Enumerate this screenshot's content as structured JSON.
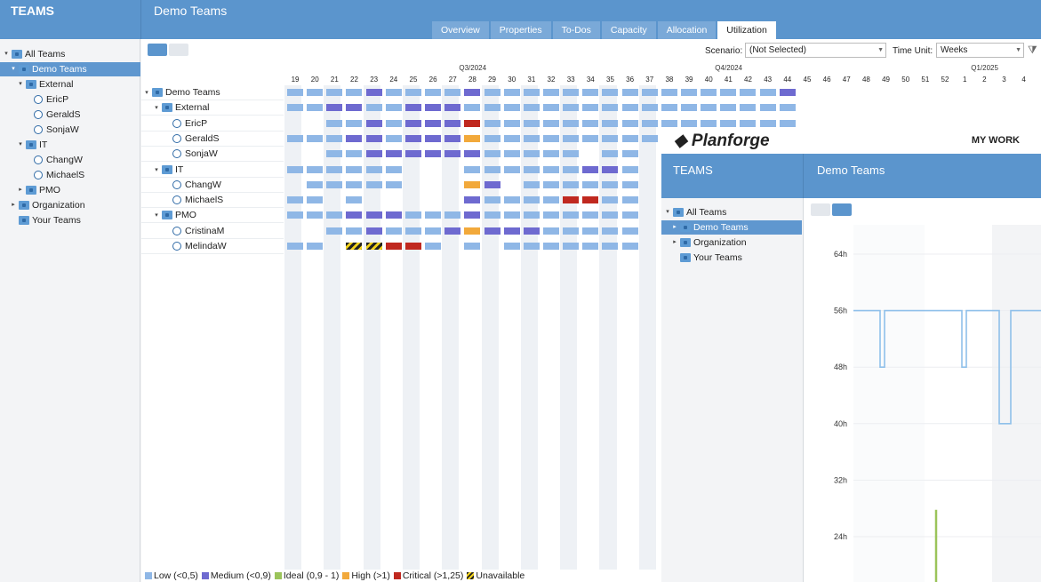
{
  "header": {
    "left_title": "TEAMS",
    "right_title": "Demo Teams"
  },
  "tabs": [
    "Overview",
    "Properties",
    "To-Dos",
    "Capacity",
    "Allocation",
    "Utilization"
  ],
  "active_tab": "Utilization",
  "sidebar": {
    "nodes": [
      {
        "label": "All Teams",
        "type": "folder",
        "level": 0,
        "caret": "▾"
      },
      {
        "label": "Demo Teams",
        "type": "folder",
        "level": 1,
        "caret": "▾",
        "selected": true
      },
      {
        "label": "External",
        "type": "folder",
        "level": 2,
        "caret": "▾"
      },
      {
        "label": "EricP",
        "type": "person",
        "level": 3
      },
      {
        "label": "GeraldS",
        "type": "person",
        "level": 3
      },
      {
        "label": "SonjaW",
        "type": "person",
        "level": 3
      },
      {
        "label": "IT",
        "type": "folder",
        "level": 2,
        "caret": "▾"
      },
      {
        "label": "ChangW",
        "type": "person",
        "level": 3
      },
      {
        "label": "MichaelS",
        "type": "person",
        "level": 3
      },
      {
        "label": "PMO",
        "type": "folder",
        "level": 2,
        "caret": "▸"
      },
      {
        "label": "Organization",
        "type": "folder",
        "level": 1,
        "caret": "▸"
      },
      {
        "label": "Your Teams",
        "type": "folder",
        "level": 1,
        "caret": ""
      }
    ]
  },
  "controls": {
    "scenario_label": "Scenario:",
    "scenario_value": "(Not Selected)",
    "time_unit_label": "Time Unit:",
    "time_unit_value": "Weeks"
  },
  "quarters": [
    {
      "label": "Q3/2024",
      "col": 9
    },
    {
      "label": "Q4/2024",
      "col": 22
    },
    {
      "label": "Q1/2025",
      "col": 35
    }
  ],
  "weeks": [
    "19",
    "20",
    "21",
    "22",
    "23",
    "24",
    "25",
    "26",
    "27",
    "28",
    "29",
    "30",
    "31",
    "32",
    "33",
    "34",
    "35",
    "36",
    "37",
    "38",
    "39",
    "40",
    "41",
    "42",
    "43",
    "44",
    "45",
    "46",
    "47",
    "48",
    "49",
    "50",
    "51",
    "52",
    "1",
    "2",
    "3",
    "4"
  ],
  "rows": [
    {
      "label": "Demo Teams",
      "type": "folder",
      "level": 0,
      "caret": "▾",
      "cells": "LLLLMLLLLMLLLLLLLLLLLLLLLMILLLLLLLLLLL"
    },
    {
      "label": "External",
      "type": "folder",
      "level": 1,
      "caret": "▾",
      "cells": "LLMMLLMMMLLLLLLLLLLLLLLLLLLLLLLLLLLLLL"
    },
    {
      "label": "EricP",
      "type": "person",
      "level": 2,
      "cells": "__LLMLMMMCLLLLLLLLLLLLLLLLLLLLLLLLLLLL"
    },
    {
      "label": "GeraldS",
      "type": "person",
      "level": 2,
      "cells": "LLLMMLMMMHLLLLLLLLLLLLLLLLLLLLLLLLLLLL"
    },
    {
      "label": "SonjaW",
      "type": "person",
      "level": 2,
      "cells": "__LLMMMMMMLLLLL_LL______________________"
    },
    {
      "label": "IT",
      "type": "folder",
      "level": 1,
      "caret": "▾",
      "cells": "LLLLLL___LLLLLLMML______________________"
    },
    {
      "label": "ChangW",
      "type": "person",
      "level": 2,
      "cells": "_LLLLL___HM_LLLLLL______________________"
    },
    {
      "label": "MichaelS",
      "type": "person",
      "level": 2,
      "cells": "LL_L_____MLLLLCCLL______________________"
    },
    {
      "label": "PMO",
      "type": "folder",
      "level": 1,
      "caret": "▾",
      "cells": "LLLMMMLLLMLLLLLLLL______________________"
    },
    {
      "label": "CristinaM",
      "type": "person",
      "level": 2,
      "cells": "__LLMLLLMHMMMLLLLL______________________"
    },
    {
      "label": "MelindaW",
      "type": "person",
      "level": 2,
      "cells": "LL_UUCCL_L_LLLLLLL______________________"
    }
  ],
  "legend": [
    {
      "label": "Low (<0,5)",
      "color": "#8fb7e6"
    },
    {
      "label": "Medium (<0,9)",
      "color": "#6e6ad0"
    },
    {
      "label": "Ideal (0,9 - 1)",
      "color": "#9bc45a"
    },
    {
      "label": "High (>1)",
      "color": "#f2a93b"
    },
    {
      "label": "Critical (>1,25)",
      "color": "#c0281f"
    },
    {
      "label": "Unavailable",
      "color": "#222222"
    }
  ],
  "overlay": {
    "logo": "Planforge",
    "my_work": "MY WORK",
    "left_title": "TEAMS",
    "right_title": "Demo Teams",
    "tree": [
      {
        "label": "All Teams",
        "caret": "▾",
        "level": 0
      },
      {
        "label": "Demo Teams",
        "caret": "▸",
        "level": 1,
        "selected": true
      },
      {
        "label": "Organization",
        "caret": "▸",
        "level": 1
      },
      {
        "label": "Your Teams",
        "caret": "",
        "level": 1
      }
    ],
    "y_ticks": [
      "64h",
      "56h",
      "48h",
      "40h",
      "32h",
      "24h"
    ]
  }
}
